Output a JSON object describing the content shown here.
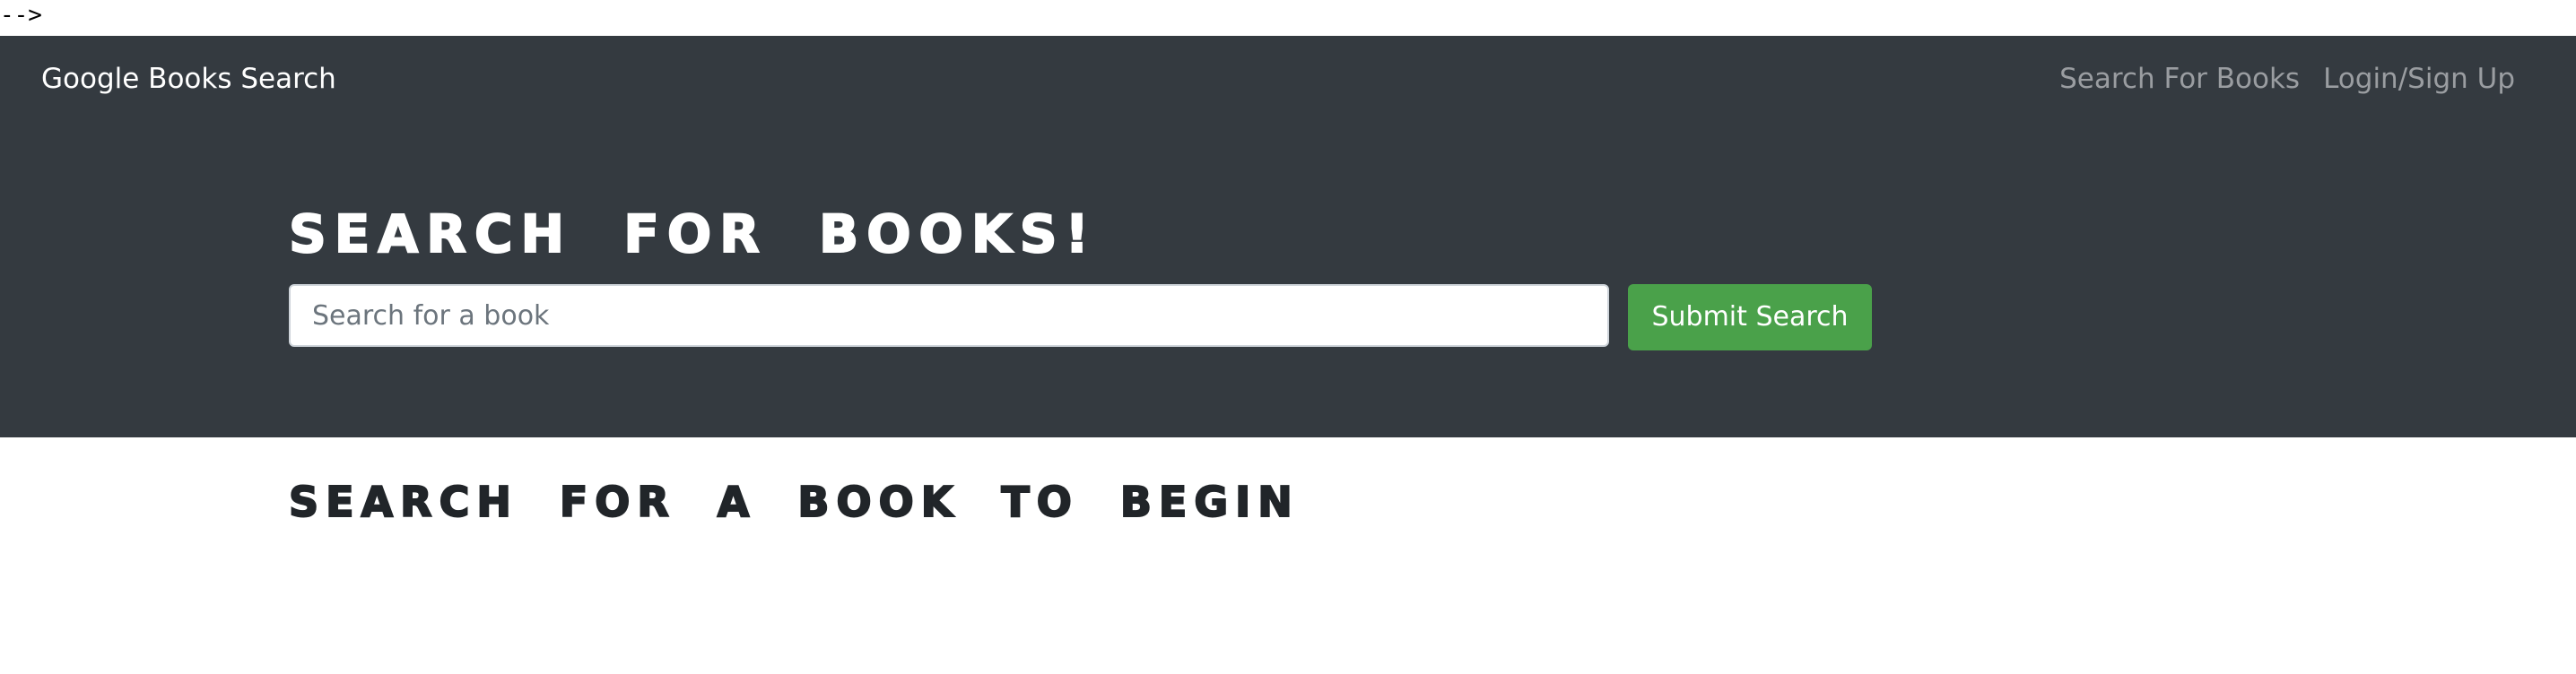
{
  "stray_text": "-->",
  "navbar": {
    "brand": "Google Books Search",
    "links": [
      {
        "label": "Search For Books"
      },
      {
        "label": "Login/Sign Up"
      }
    ]
  },
  "hero": {
    "title": "SEARCH FOR BOOKS!",
    "search": {
      "placeholder": "Search for a book",
      "value": ""
    },
    "submit_label": "Submit Search"
  },
  "results": {
    "heading": "SEARCH FOR A BOOK TO BEGIN"
  },
  "colors": {
    "navbar_bg": "#343a40",
    "hero_bg": "#343a40",
    "submit_bg": "#4aa14a",
    "nav_link": "#9a9da1",
    "heading_dark": "#212529"
  }
}
